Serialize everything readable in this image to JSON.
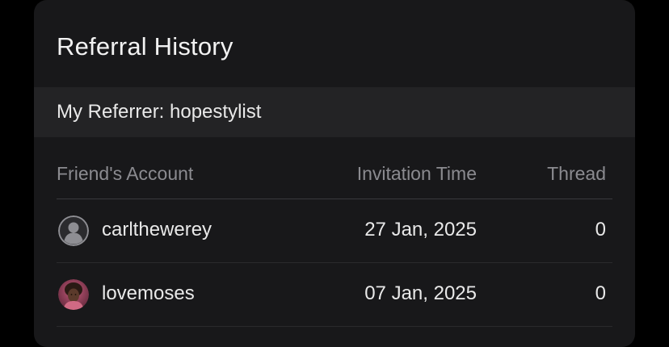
{
  "referral_history": {
    "title": "Referral History",
    "referrer_label": "My Referrer: hopestylist",
    "columns": {
      "account": "Friend's Account",
      "invitation_time": "Invitation Time",
      "thread": "Thread"
    },
    "rows": [
      {
        "username": "carlthewerey",
        "invitation_time": "27 Jan, 2025",
        "thread": "0",
        "avatar": "default-user-icon"
      },
      {
        "username": "lovemoses",
        "invitation_time": "07 Jan, 2025",
        "thread": "0",
        "avatar": "user-photo"
      }
    ]
  },
  "colors": {
    "background": "#000000",
    "card": "#18181a",
    "referrer_bar": "#232325",
    "text_primary": "#e9e9e9",
    "text_muted": "#8b8b90"
  }
}
